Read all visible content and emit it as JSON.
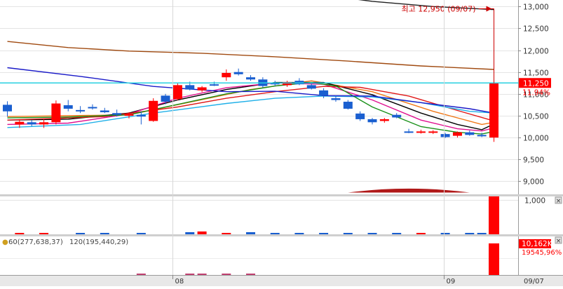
{
  "chart_data": [
    {
      "type": "candlestick",
      "pane": "price",
      "ylim": [
        8700,
        13150
      ],
      "y_ticks": [
        9000,
        9500,
        10000,
        10500,
        11000,
        11500,
        12000,
        12500,
        13000
      ],
      "y_tick_labels": [
        "9,000",
        "9,500",
        "10,000",
        "10,500",
        "11,000",
        "11,500",
        "12,000",
        "12,500",
        "13,000"
      ],
      "candles": [
        {
          "o": 10600,
          "h": 10830,
          "l": 10480,
          "c": 10750,
          "up": false
        },
        {
          "o": 10300,
          "h": 10420,
          "l": 10220,
          "c": 10360,
          "up": true
        },
        {
          "o": 10350,
          "h": 10400,
          "l": 10260,
          "c": 10300,
          "up": false
        },
        {
          "o": 10300,
          "h": 10420,
          "l": 10220,
          "c": 10350,
          "up": true
        },
        {
          "o": 10350,
          "h": 10850,
          "l": 10300,
          "c": 10780,
          "up": true
        },
        {
          "o": 10740,
          "h": 10860,
          "l": 10600,
          "c": 10660,
          "up": false
        },
        {
          "o": 10630,
          "h": 10720,
          "l": 10560,
          "c": 10600,
          "up": false
        },
        {
          "o": 10700,
          "h": 10760,
          "l": 10640,
          "c": 10670,
          "up": false
        },
        {
          "o": 10620,
          "h": 10680,
          "l": 10560,
          "c": 10580,
          "up": false
        },
        {
          "o": 10560,
          "h": 10640,
          "l": 10480,
          "c": 10520,
          "up": false
        },
        {
          "o": 10500,
          "h": 10580,
          "l": 10440,
          "c": 10540,
          "up": true
        },
        {
          "o": 10520,
          "h": 10600,
          "l": 10300,
          "c": 10480,
          "up": false
        },
        {
          "o": 10380,
          "h": 10900,
          "l": 10360,
          "c": 10840,
          "up": true
        },
        {
          "o": 10820,
          "h": 11000,
          "l": 10760,
          "c": 10960,
          "up": false
        },
        {
          "o": 10880,
          "h": 11250,
          "l": 10850,
          "c": 11200,
          "up": true
        },
        {
          "o": 11200,
          "h": 11280,
          "l": 11080,
          "c": 11100,
          "up": false
        },
        {
          "o": 11080,
          "h": 11180,
          "l": 11040,
          "c": 11150,
          "up": true
        },
        {
          "o": 11220,
          "h": 11280,
          "l": 11180,
          "c": 11200,
          "up": false
        },
        {
          "o": 11380,
          "h": 11560,
          "l": 11300,
          "c": 11480,
          "up": true
        },
        {
          "o": 11500,
          "h": 11580,
          "l": 11420,
          "c": 11450,
          "up": false
        },
        {
          "o": 11380,
          "h": 11430,
          "l": 11300,
          "c": 11330,
          "up": false
        },
        {
          "o": 11330,
          "h": 11380,
          "l": 11140,
          "c": 11180,
          "up": false
        },
        {
          "o": 11250,
          "h": 11300,
          "l": 11180,
          "c": 11220,
          "up": false
        },
        {
          "o": 11200,
          "h": 11300,
          "l": 11160,
          "c": 11270,
          "up": true
        },
        {
          "o": 11300,
          "h": 11360,
          "l": 11200,
          "c": 11220,
          "up": false
        },
        {
          "o": 11200,
          "h": 11260,
          "l": 11100,
          "c": 11120,
          "up": false
        },
        {
          "o": 11080,
          "h": 11130,
          "l": 10900,
          "c": 10960,
          "up": false
        },
        {
          "o": 10900,
          "h": 10960,
          "l": 10820,
          "c": 10860,
          "up": false
        },
        {
          "o": 10820,
          "h": 10860,
          "l": 10640,
          "c": 10660,
          "up": false
        },
        {
          "o": 10550,
          "h": 10600,
          "l": 10380,
          "c": 10420,
          "up": false
        },
        {
          "o": 10420,
          "h": 10450,
          "l": 10300,
          "c": 10350,
          "up": false
        },
        {
          "o": 10380,
          "h": 10450,
          "l": 10340,
          "c": 10420,
          "up": true
        },
        {
          "o": 10520,
          "h": 10560,
          "l": 10440,
          "c": 10460,
          "up": false
        },
        {
          "o": 10140,
          "h": 10200,
          "l": 10100,
          "c": 10120,
          "up": false
        },
        {
          "o": 10120,
          "h": 10180,
          "l": 10090,
          "c": 10140,
          "up": true
        },
        {
          "o": 10110,
          "h": 10170,
          "l": 10080,
          "c": 10140,
          "up": true
        },
        {
          "o": 10080,
          "h": 10110,
          "l": 9990,
          "c": 10010,
          "up": false
        },
        {
          "o": 10040,
          "h": 10140,
          "l": 10000,
          "c": 10120,
          "up": true
        },
        {
          "o": 10120,
          "h": 10160,
          "l": 10040,
          "c": 10060,
          "up": false
        },
        {
          "o": 10060,
          "h": 10110,
          "l": 10010,
          "c": 10040,
          "up": false
        },
        {
          "o": 10000,
          "h": 12950,
          "l": 9900,
          "c": 11250,
          "up": true
        }
      ],
      "moving_averages": [
        {
          "color": "#f07818",
          "values": [
            [
              0,
              10480
            ],
            [
              10,
              10520
            ],
            [
              20,
              11100
            ],
            [
              25,
              11300
            ],
            [
              30,
              11050
            ],
            [
              35,
              10600
            ],
            [
              39,
              10300
            ],
            [
              40,
              10350
            ]
          ]
        },
        {
          "color": "#000000",
          "values": [
            [
              0,
              10400
            ],
            [
              5,
              10420
            ],
            [
              10,
              10560
            ],
            [
              14,
              10860
            ],
            [
              18,
              11100
            ],
            [
              22,
              11260
            ],
            [
              26,
              11260
            ],
            [
              30,
              10980
            ],
            [
              34,
              10560
            ],
            [
              37,
              10300
            ],
            [
              39,
              10180
            ],
            [
              40,
              10310
            ]
          ]
        },
        {
          "color": "#e01090",
          "values": [
            [
              0,
              10300
            ],
            [
              5,
              10330
            ],
            [
              10,
              10540
            ],
            [
              14,
              10900
            ],
            [
              18,
              11140
            ],
            [
              22,
              11250
            ],
            [
              26,
              11220
            ],
            [
              30,
              10860
            ],
            [
              34,
              10400
            ],
            [
              37,
              10200
            ],
            [
              39,
              10150
            ],
            [
              40,
              10220
            ]
          ]
        },
        {
          "color": "#e01818",
          "values": [
            [
              0,
              10400
            ],
            [
              8,
              10480
            ],
            [
              14,
              10700
            ],
            [
              18,
              10900
            ],
            [
              22,
              11050
            ],
            [
              26,
              11170
            ],
            [
              29,
              11150
            ],
            [
              33,
              10950
            ],
            [
              37,
              10620
            ],
            [
              40,
              10380
            ]
          ]
        },
        {
          "color": "#20b0e8",
          "values": [
            [
              0,
              10230
            ],
            [
              6,
              10300
            ],
            [
              12,
              10560
            ],
            [
              18,
              10780
            ],
            [
              22,
              10900
            ],
            [
              26,
              10950
            ],
            [
              30,
              10930
            ],
            [
              34,
              10800
            ],
            [
              38,
              10600
            ],
            [
              40,
              10560
            ]
          ]
        },
        {
          "color": "#189018",
          "values": [
            [
              0,
              10450
            ],
            [
              5,
              10470
            ],
            [
              10,
              10520
            ],
            [
              14,
              10760
            ],
            [
              18,
              11000
            ],
            [
              22,
              11180
            ],
            [
              25,
              11260
            ],
            [
              27,
              11180
            ],
            [
              30,
              10700
            ],
            [
              34,
              10250
            ],
            [
              37,
              10120
            ],
            [
              39,
              10080
            ],
            [
              40,
              10140
            ]
          ]
        },
        {
          "color": "#1a1ac8",
          "values": [
            [
              0,
              11600
            ],
            [
              6,
              11400
            ],
            [
              12,
              11170
            ],
            [
              18,
              11050
            ],
            [
              22,
              11060
            ],
            [
              26,
              10960
            ],
            [
              30,
              10950
            ],
            [
              34,
              10800
            ],
            [
              38,
              10660
            ],
            [
              40,
              10560
            ]
          ]
        },
        {
          "color": "#a04a10",
          "values": [
            [
              0,
              12200
            ],
            [
              5,
              12060
            ],
            [
              10,
              11980
            ],
            [
              16,
              11930
            ],
            [
              22,
              11850
            ],
            [
              28,
              11750
            ],
            [
              34,
              11640
            ],
            [
              40,
              11560
            ]
          ]
        },
        {
          "color": "#202020",
          "values": [
            [
              25,
              13300
            ],
            [
              30,
              13120
            ],
            [
              35,
              13000
            ],
            [
              40,
              12930
            ]
          ]
        }
      ],
      "reference_line": {
        "value": 11250,
        "color": "#28d0e0"
      },
      "annotation": {
        "text": "최고 12,950 (09/07)",
        "value": 12950,
        "candle": 40
      },
      "last_price_label": "11,250",
      "change_label": "11.94%",
      "volume_profile_hump": {
        "from": 28,
        "to": 38,
        "base": 8740,
        "peak": 8830
      }
    },
    {
      "type": "bar",
      "pane": "volume",
      "ylim": [
        0,
        1100
      ],
      "y_tick_labels": [
        "1,000"
      ],
      "small_bar_candles": [
        [
          1,
          1
        ],
        [
          3,
          1
        ],
        [
          6,
          1
        ],
        [
          8,
          1
        ],
        [
          11,
          1
        ],
        [
          15,
          2
        ],
        [
          16,
          3
        ],
        [
          18,
          1
        ],
        [
          20,
          2
        ],
        [
          22,
          1
        ],
        [
          24,
          1
        ],
        [
          26,
          1
        ],
        [
          28,
          1
        ],
        [
          30,
          1
        ],
        [
          32,
          1
        ],
        [
          34,
          1
        ],
        [
          36,
          1
        ],
        [
          38,
          1
        ],
        [
          39,
          1
        ]
      ],
      "last_bar": {
        "candle": 40,
        "value": 1100,
        "color": "#ff0000"
      }
    },
    {
      "type": "bar",
      "pane": "amount",
      "legend": [
        "60(277,638,37)",
        "120(195,440,29)"
      ],
      "last_value_label": "10,162K",
      "secondary_label": "19545,96%",
      "last_bar": {
        "candle": 40,
        "value_ratio": 1.0,
        "color": "#ff0000"
      }
    }
  ],
  "x_axis": {
    "labels": [
      {
        "candle": 13.6,
        "text": "08"
      },
      {
        "candle": 35.9,
        "text": "09"
      }
    ],
    "right_label": "09/07"
  },
  "ui": {
    "close_icon_glyph": "×"
  },
  "colors": {
    "up": "#ff0000",
    "down": "#1a5fd0",
    "axis_bg": "#e8e8e8",
    "annotation": "#cc0000"
  }
}
